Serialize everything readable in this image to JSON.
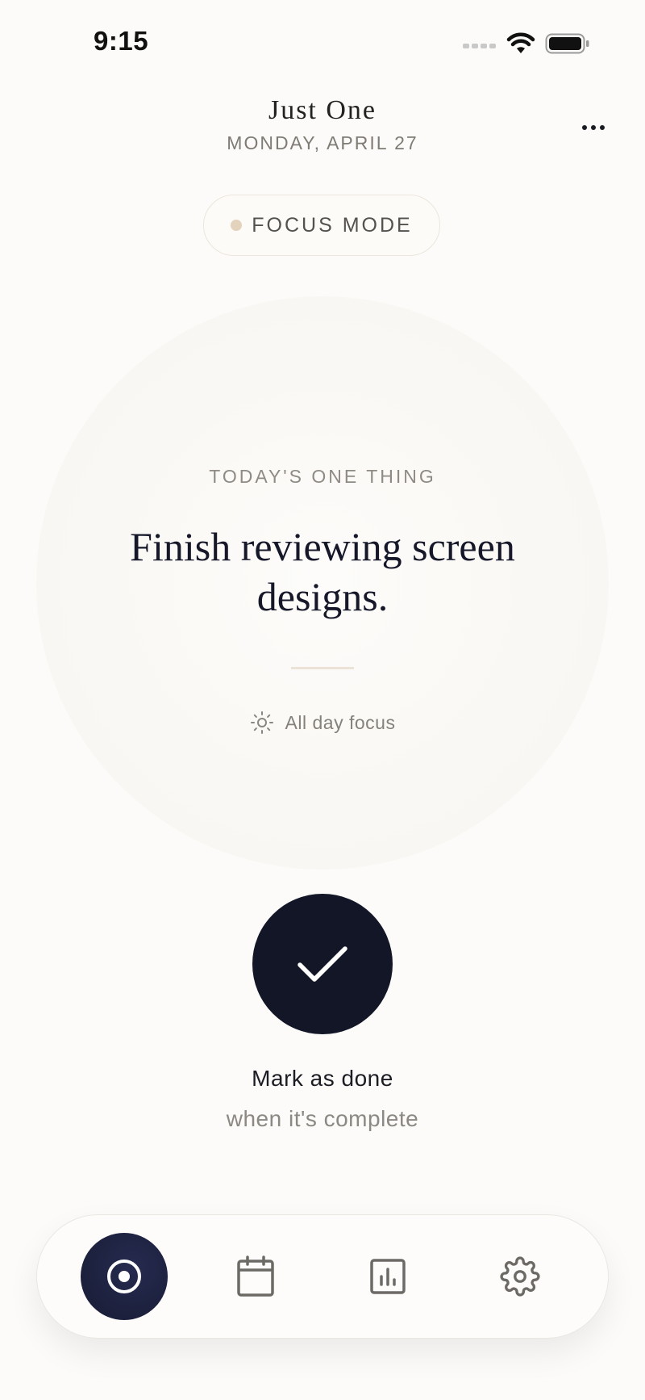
{
  "status_bar": {
    "time": "9:15"
  },
  "header": {
    "title": "Just One",
    "date": "MONDAY, APRIL 27",
    "more_icon": "more-horizontal-icon"
  },
  "mode_pill": {
    "label": "FOCUS MODE",
    "dot_color": "#e3d3bd"
  },
  "focus": {
    "eyebrow": "TODAY'S ONE THING",
    "task": "Finish reviewing screen designs.",
    "duration_icon": "sun-icon",
    "duration": "All day focus"
  },
  "done": {
    "icon": "check-icon",
    "title": "Mark as done",
    "subtitle": "when it's complete",
    "color": "#121626"
  },
  "nav": {
    "items": [
      {
        "name": "focus",
        "icon": "target-icon",
        "active": true
      },
      {
        "name": "calendar",
        "icon": "calendar-icon",
        "active": false
      },
      {
        "name": "stats",
        "icon": "bar-chart-icon",
        "active": false
      },
      {
        "name": "settings",
        "icon": "gear-icon",
        "active": false
      }
    ],
    "active_color": "#1c2140"
  },
  "colors": {
    "background": "#fcfbf9",
    "text": "#1a1c24",
    "muted": "#8c8883",
    "accent": "#e3d3bd"
  }
}
